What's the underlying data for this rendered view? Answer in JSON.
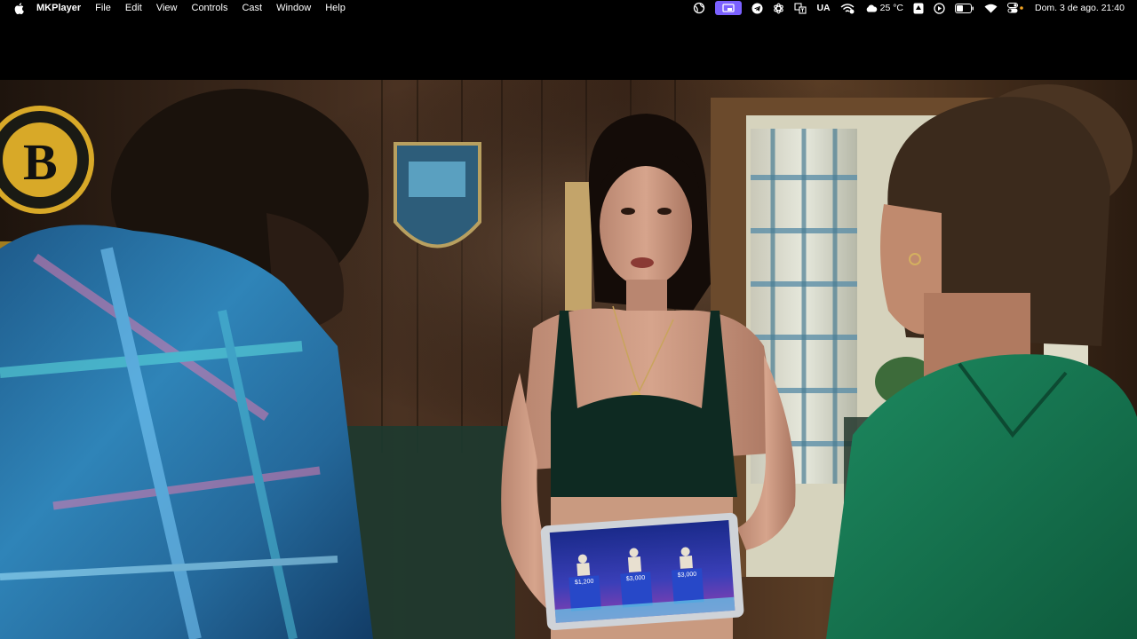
{
  "menubar": {
    "app_name": "MKPlayer",
    "items": [
      "File",
      "Edit",
      "View",
      "Controls",
      "Cast",
      "Window",
      "Help"
    ]
  },
  "status_bar": {
    "icons": [
      "vpn-globe-icon",
      "cast-screen-icon",
      "telegram-icon",
      "chatgpt-icon",
      "translate-icon",
      "keyboard-layout",
      "wifi-calling-icon",
      "weather-cloud-icon",
      "arrow-up-box-icon",
      "play-circle-icon",
      "battery-icon",
      "wifi-icon",
      "control-center-icon"
    ],
    "keyboard_layout": "UA",
    "weather_temp": "25 °C",
    "datetime": "Dom. 3 de ago.  21:40",
    "accent_color": "#7b61ff"
  },
  "video": {
    "content": "movie-frame",
    "tablet_screen": {
      "scores": [
        "$1,200",
        "$3,000",
        "$3,000"
      ]
    }
  }
}
